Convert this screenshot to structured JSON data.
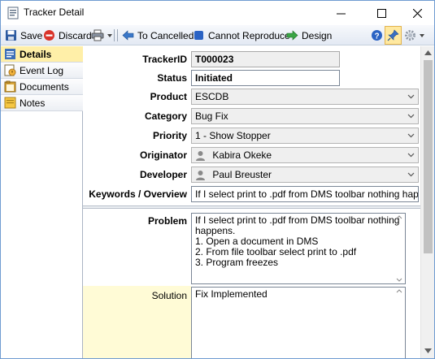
{
  "window": {
    "title": "Tracker Detail"
  },
  "toolbar": {
    "save_label": "Save",
    "discard_label": "Discard",
    "to_cancelled_label": "To Cancelled",
    "cannot_reproduce_label": "Cannot Reproduce",
    "design_label": "Design"
  },
  "nav": {
    "items": [
      {
        "label": "Details",
        "icon": "details-icon",
        "active": true
      },
      {
        "label": "Event Log",
        "icon": "event-log-icon",
        "active": false
      },
      {
        "label": "Documents",
        "icon": "documents-icon",
        "active": false
      },
      {
        "label": "Notes",
        "icon": "notes-icon",
        "active": false
      }
    ]
  },
  "form": {
    "tracker_id": {
      "label": "TrackerID",
      "value": "T000023"
    },
    "status": {
      "label": "Status",
      "value": "Initiated"
    },
    "product": {
      "label": "Product",
      "value": "ESCDB"
    },
    "category": {
      "label": "Category",
      "value": "Bug Fix"
    },
    "priority": {
      "label": "Priority",
      "value": "1 - Show Stopper"
    },
    "originator": {
      "label": "Originator",
      "value": "Kabira Okeke"
    },
    "developer": {
      "label": "Developer",
      "value": "Paul Breuster"
    },
    "keywords": {
      "label": "Keywords / Overview",
      "value": "If I select print to .pdf from DMS toolbar nothing happ"
    },
    "problem": {
      "label": "Problem",
      "lines": [
        "If I select print to .pdf from DMS toolbar nothing",
        "happens.",
        "1. Open a document in DMS",
        "2. From file toolbar select print to .pdf",
        "3. Program freezes"
      ]
    },
    "solution": {
      "label": "Solution",
      "lines": [
        "Fix Implemented"
      ]
    }
  },
  "colors": {
    "accent": "#1f5fbf",
    "active_nav": "#ffefa8",
    "solution_label_bg": "#fffbd6"
  }
}
